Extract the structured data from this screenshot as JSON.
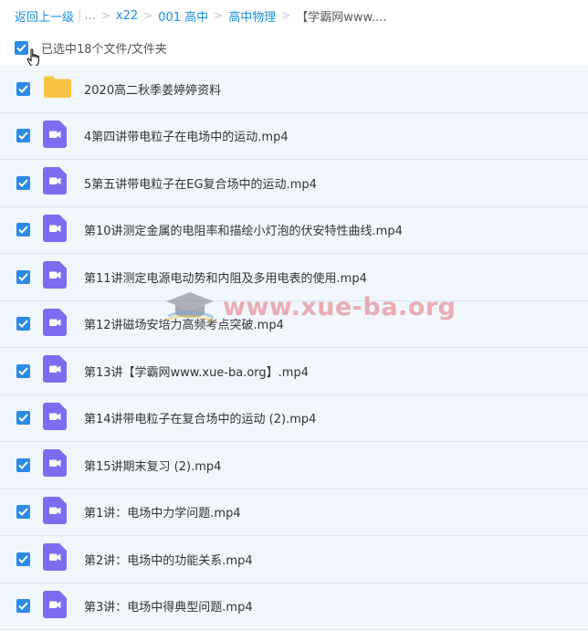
{
  "breadcrumb": {
    "back": "返回上一级",
    "ellipsis": "...",
    "items": [
      "x22",
      "001 高中",
      "高中物理"
    ],
    "current": "【学霸网www...."
  },
  "selection": {
    "text": "已选中18个文件/文件夹"
  },
  "files": [
    {
      "name": "2020高二秋季姜婷婷资料",
      "type": "folder"
    },
    {
      "name": "4第四讲带电粒子在电场中的运动.mp4",
      "type": "video"
    },
    {
      "name": "5第五讲带电粒子在EG复合场中的运动.mp4",
      "type": "video"
    },
    {
      "name": "第10讲测定金属的电阻率和描绘小灯泡的伏安特性曲线.mp4",
      "type": "video"
    },
    {
      "name": "第11讲测定电源电动势和内阻及多用电表的使用.mp4",
      "type": "video"
    },
    {
      "name": "第12讲磁场安培力高频考点突破.mp4",
      "type": "video"
    },
    {
      "name": "第13讲【学霸网www.xue-ba.org】.mp4",
      "type": "video"
    },
    {
      "name": "第14讲带电粒子在复合场中的运动 (2).mp4",
      "type": "video"
    },
    {
      "name": "第15讲期末复习 (2).mp4",
      "type": "video"
    },
    {
      "name": "第1讲：电场中力学问题.mp4",
      "type": "video"
    },
    {
      "name": "第2讲：电场中的功能关系.mp4",
      "type": "video"
    },
    {
      "name": "第3讲：电场中得典型问题.mp4",
      "type": "video"
    }
  ],
  "watermark": {
    "text": "www.xue-ba.org"
  },
  "colors": {
    "accent": "#2b8ae6",
    "link": "#1a8fe3",
    "folder": "#f7c342",
    "video": "#7b6cf0",
    "row_bg": "#f0f6fc"
  }
}
